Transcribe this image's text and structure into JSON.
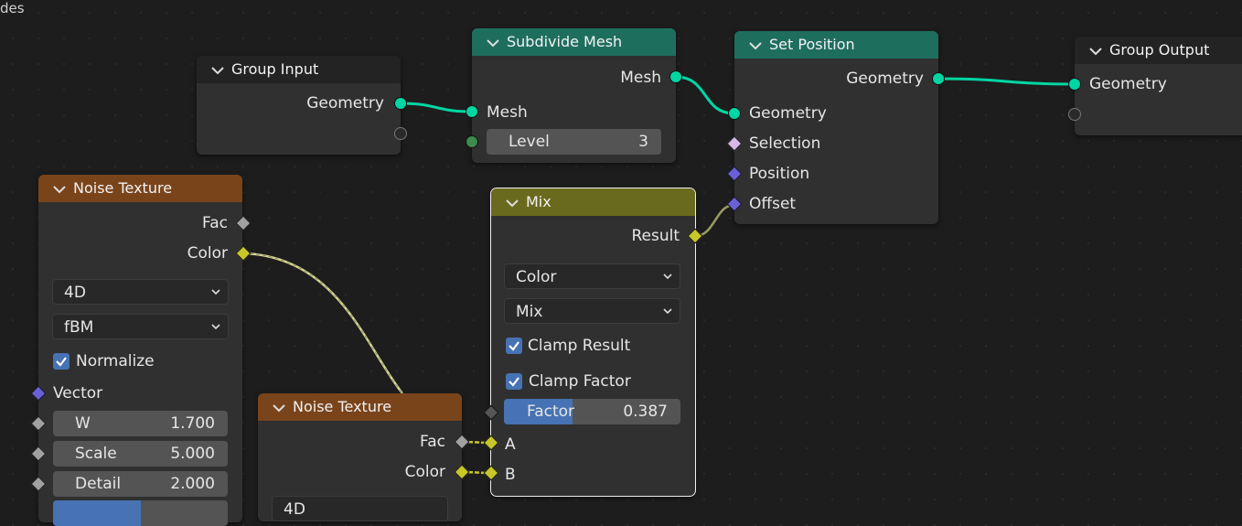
{
  "corner_text": "des",
  "colors": {
    "geometry_socket": "#00d6a3",
    "geometry_header": "#1e6e5e",
    "texture_header": "#7a441b",
    "mix_header": "#6a6a1e",
    "vector_socket": "#6a5fd6",
    "color_socket": "#c7c729",
    "float_socket": "#a1a1a1",
    "accent": "#4772b3"
  },
  "nodes": {
    "group_input": {
      "title": "Group Input",
      "output": "Geometry"
    },
    "subdivide": {
      "title": "Subdivide Mesh",
      "output": "Mesh",
      "input": "Mesh",
      "level_label": "Level",
      "level_value": "3"
    },
    "set_position": {
      "title": "Set Position",
      "output": "Geometry",
      "inputs": [
        "Geometry",
        "Selection",
        "Position",
        "Offset"
      ]
    },
    "group_output": {
      "title": "Group Output",
      "input": "Geometry"
    },
    "noise1": {
      "title": "Noise Texture",
      "outputs": [
        "Fac",
        "Color"
      ],
      "dimensions": "4D",
      "noise_type": "fBM",
      "normalize_label": "Normalize",
      "vector_label": "Vector",
      "fields": [
        {
          "label": "W",
          "value": "1.700"
        },
        {
          "label": "Scale",
          "value": "5.000"
        },
        {
          "label": "Detail",
          "value": "2.000"
        }
      ]
    },
    "noise2": {
      "title": "Noise Texture",
      "outputs": [
        "Fac",
        "Color"
      ],
      "dimensions_partial": "4D"
    },
    "mix": {
      "title": "Mix",
      "output": "Result",
      "data_type": "Color",
      "blend": "Mix",
      "clamp_result": "Clamp Result",
      "clamp_factor": "Clamp Factor",
      "factor_label": "Factor",
      "factor_value": "0.387",
      "factor_fraction": 0.387,
      "inputs": [
        "A",
        "B"
      ]
    }
  }
}
